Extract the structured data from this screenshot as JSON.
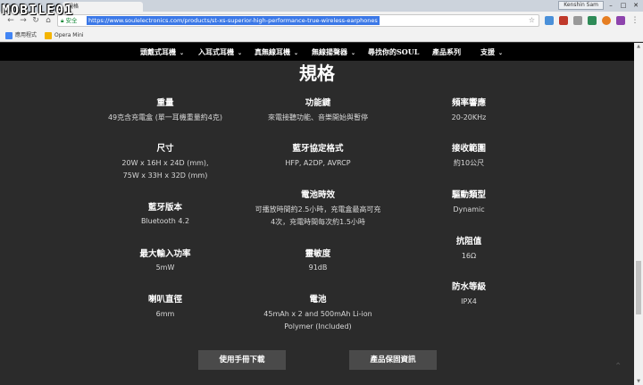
{
  "browser": {
    "tab_title": "規格",
    "user": "Kenshin Sam",
    "secure_label": "安全",
    "url": "https://www.soulelectronics.com/products/st-xs-superior-high-performance-true-wireless-earphones",
    "bookmarks": [
      {
        "label": "應用程式",
        "color": "#4285f4"
      },
      {
        "label": "Opera Mini",
        "color": "#f4b400"
      }
    ]
  },
  "watermark": "MOBILE01",
  "site_nav": [
    {
      "label": "頭戴式耳機",
      "chevron": true
    },
    {
      "label": "入耳式耳機",
      "chevron": true
    },
    {
      "label": "真無線耳機",
      "chevron": true
    },
    {
      "label": "無線揚聲器",
      "chevron": true
    },
    {
      "label": "尋找你的SOUL",
      "chevron": false
    },
    {
      "label": "產品系列",
      "chevron": false
    },
    {
      "label": "支援",
      "chevron": true
    }
  ],
  "page_title": "規格",
  "specs": [
    {
      "label": "重量",
      "value": "49克含充電盒 (單一耳機重量約4克)"
    },
    {
      "label": "尺寸",
      "value": "20W x 16H x 24D (mm),",
      "value2": "75W x 33H x 32D (mm)"
    },
    {
      "label": "藍牙版本",
      "value": "Bluetooth 4.2"
    },
    {
      "label": "最大輸入功率",
      "value": "5mW"
    },
    {
      "label": "喇叭直徑",
      "value": "6mm"
    },
    {
      "label": "功能鍵",
      "value": "來電接聽功能、音樂開始與暫停"
    },
    {
      "label": "藍牙協定格式",
      "value": "HFP, A2DP, AVRCP"
    },
    {
      "label": "電池時效",
      "value": "可播放時間約2.5小時，充電盒最高可充",
      "value2": "4次，充電時間每次約1.5小時"
    },
    {
      "label": "靈敏度",
      "value": "91dB"
    },
    {
      "label": "電池",
      "value": "45mAh x 2 and 500mAh Li-ion",
      "value2": "Polymer (Included)"
    },
    {
      "label": "頻率響應",
      "value": "20-20KHz"
    },
    {
      "label": "接收範圍",
      "value": "約10公尺"
    },
    {
      "label": "驅動類型",
      "value": "Dynamic"
    },
    {
      "label": "抗阻值",
      "value": "16Ω"
    },
    {
      "label": "防水等級",
      "value": "IPX4"
    }
  ],
  "buttons": {
    "manual": "使用手冊下載",
    "warranty": "產品保固資訊"
  }
}
